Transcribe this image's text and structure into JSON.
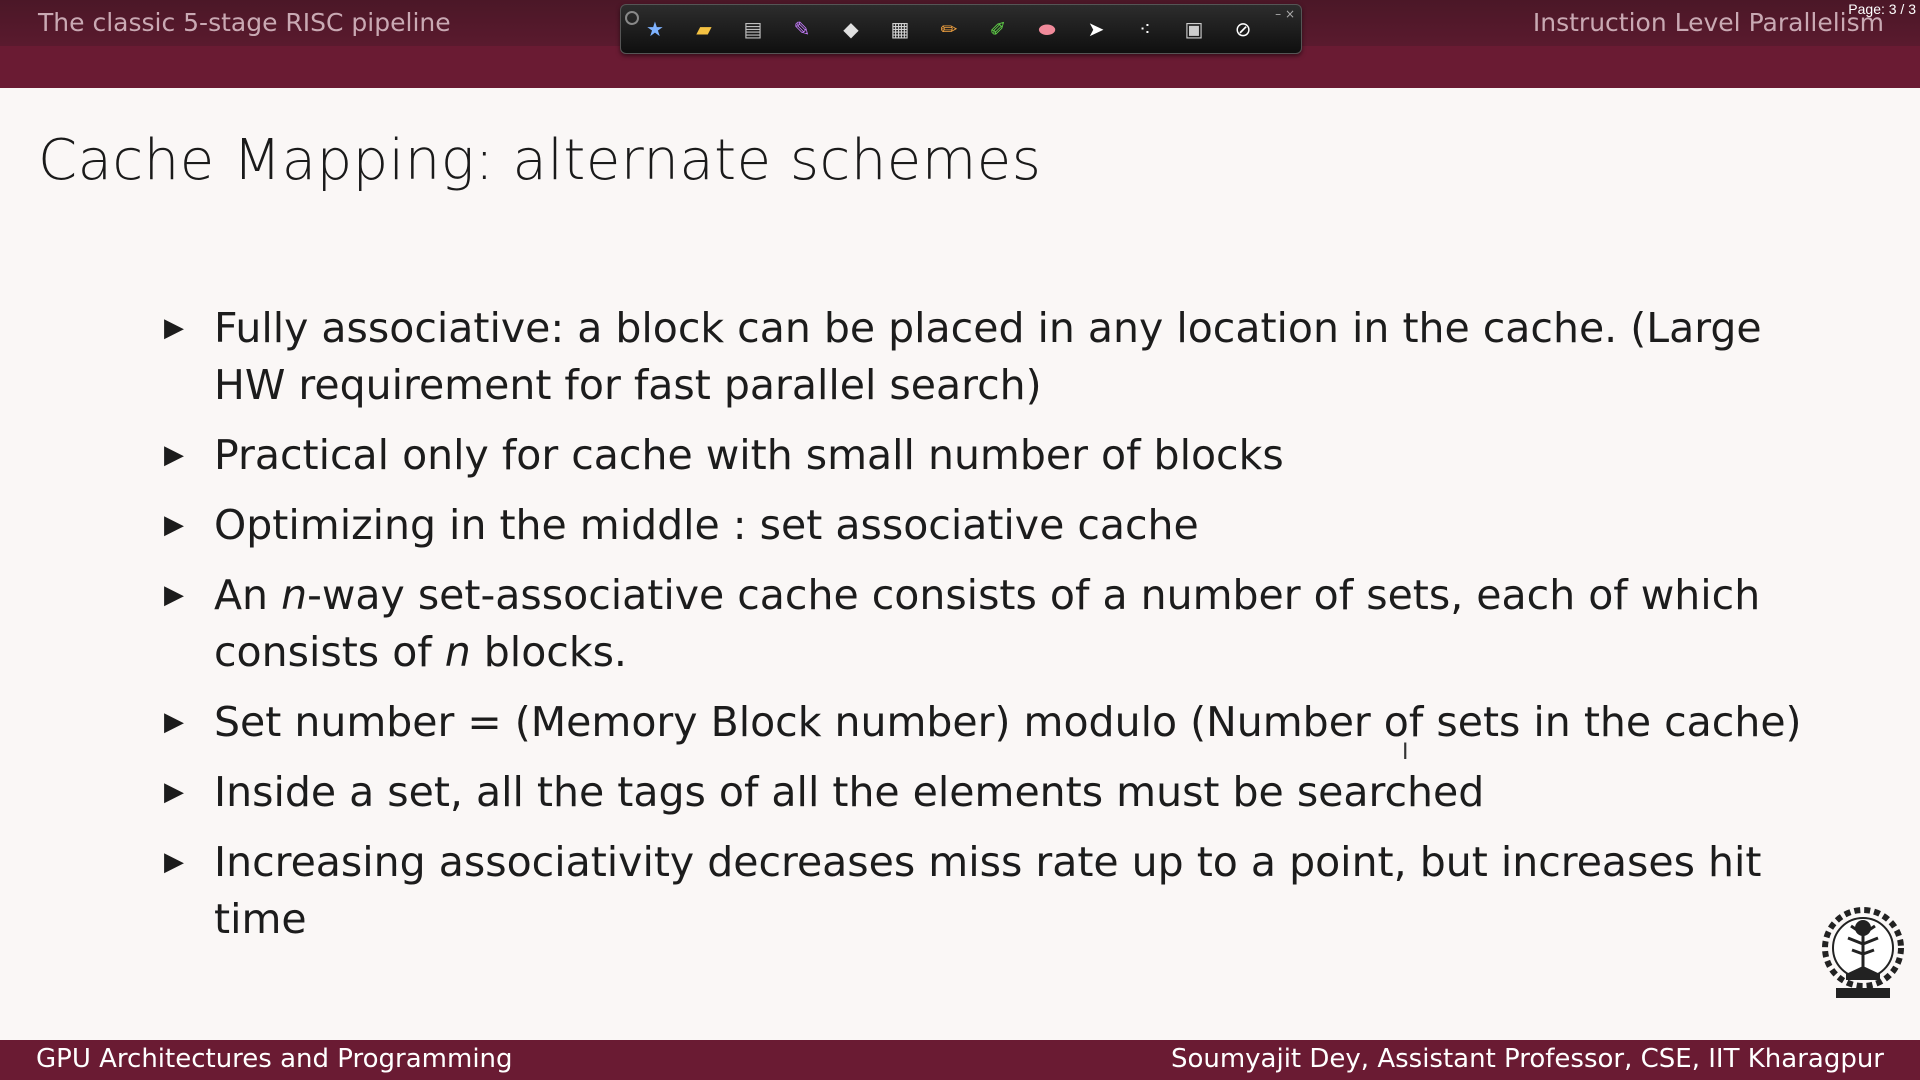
{
  "header": {
    "left_title": "The classic 5-stage RISC pipeline",
    "right_title": "Instruction Level Parallelism",
    "page_indicator": "Page: 3 / 3"
  },
  "toolbar": {
    "tools": [
      {
        "name": "new-slide-icon",
        "glyph": "★",
        "color": "#7fb3ff"
      },
      {
        "name": "open-folder-icon",
        "glyph": "▰",
        "color": "#f5c242"
      },
      {
        "name": "save-icon",
        "glyph": "▤",
        "color": "#bfbfbf"
      },
      {
        "name": "pen-icon",
        "glyph": "✎",
        "color": "#c77dff"
      },
      {
        "name": "eraser-page-icon",
        "glyph": "◆",
        "color": "#e0e0e0"
      },
      {
        "name": "print-icon",
        "glyph": "▦",
        "color": "#cfcfcf"
      },
      {
        "name": "pencil-icon",
        "glyph": "✏",
        "color": "#f4a340"
      },
      {
        "name": "highlighter-icon",
        "glyph": "✐",
        "color": "#63d84a"
      },
      {
        "name": "eraser-icon",
        "glyph": "⬬",
        "color": "#f08a9a"
      },
      {
        "name": "pointer-icon",
        "glyph": "➤",
        "color": "#ffffff"
      },
      {
        "name": "laser-dots-icon",
        "glyph": "⁖",
        "color": "#ffffff"
      },
      {
        "name": "clear-screen-icon",
        "glyph": "▣",
        "color": "#cccccc"
      },
      {
        "name": "stop-icon",
        "glyph": "⊘",
        "color": "#ffffff"
      }
    ]
  },
  "slide": {
    "title": "Cache Mapping: alternate schemes",
    "bullets": [
      "Fully associative: a block can be placed in any location in the cache. (Large HW requirement for fast parallel search)",
      "Practical only for cache with small number of blocks",
      "Optimizing in the middle : set associative cache",
      {
        "pre": "An ",
        "var1": "n",
        "mid": "-way set-associative cache consists of a number of sets, each of which consists of ",
        "var2": "n",
        "post": " blocks."
      },
      "Set number = (Memory Block number) modulo (Number of sets in the cache)",
      "Inside a set, all the tags of all the elements must be searched",
      "Increasing associativity decreases miss rate up to a point, but increases hit time"
    ],
    "bullet_marker": "▶"
  },
  "footer": {
    "left": "GPU Architectures and Programming",
    "right": "Soumyajit Dey, Assistant Professor, CSE, IIT Kharagpur"
  },
  "colors": {
    "header_bg": "#6a1b33",
    "slide_bg": "#faf7f6",
    "text": "#1c1c1c"
  }
}
